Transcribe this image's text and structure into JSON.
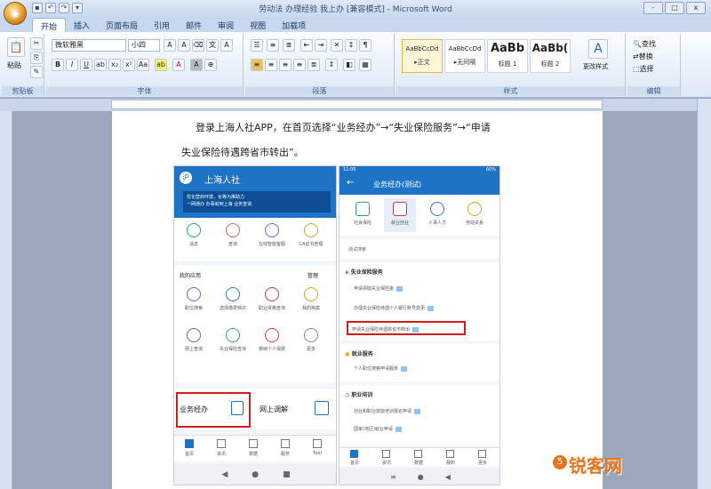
{
  "window": {
    "title": "劳动法 办理经验 我上办 [兼容模式] - Microsoft Word",
    "controls": [
      "-",
      "□",
      "x"
    ]
  },
  "tabs": [
    "开始",
    "插入",
    "页面布局",
    "引用",
    "邮件",
    "审阅",
    "视图",
    "加载项"
  ],
  "ribbon": {
    "clipboard": {
      "paste": "粘贴",
      "label": "剪贴板"
    },
    "font": {
      "name": "微软雅黑",
      "size": "小四",
      "label": "字体"
    },
    "paragraph": {
      "label": "段落"
    },
    "styles": {
      "label": "样式",
      "items": [
        {
          "preview": "AaBbCcDd",
          "name": "▸正文"
        },
        {
          "preview": "AaBbCcDd",
          "name": "▸无间隔"
        },
        {
          "preview": "AaBb",
          "name": "标题 1"
        },
        {
          "preview": "AaBb(",
          "name": "标题 2"
        }
      ],
      "change": "更改样式"
    },
    "editing": {
      "label": "编辑",
      "find": "查找",
      "replace": "替换",
      "select": "选择"
    }
  },
  "doc": {
    "line1": "登录上海人社APP，在首页选择“业务经办”→“失业保险服务”→“申请",
    "line2": "失业保险待遇跨省市转出”。"
  },
  "left_screen": {
    "app": "上海人社",
    "banner": "优化营商环境，化等为推助力",
    "banner2": "一网通办   办事就到上海  业务查询",
    "top_icons": [
      "消息",
      "查询",
      "在线智能客服",
      "CA证书管理"
    ],
    "myapps": "我的应用",
    "manage": "管理",
    "apps": [
      "职位搜索",
      "选择缴费档次",
      "职业资格查询",
      "我的档案",
      "网上查询",
      "失业保险查询",
      "缴纳个人保费",
      "更多"
    ],
    "biz": "业务经办",
    "online": "网上调解",
    "nav": [
      "首页",
      "资讯",
      "数据",
      "服务",
      "Tool"
    ]
  },
  "right_screen": {
    "status_time": "11:05",
    "status_right": "60%",
    "header": "业务经办(测试)",
    "top_icons": [
      "社会保险",
      "就业创业",
      "人事人才",
      "劳动关系"
    ],
    "search": "测试搜索",
    "sec1": "失业保险服务",
    "sec1_items": [
      "申请领取失业保险金",
      "办理失业保险待遇个人银行账号变更",
      "申请失业保险待遇跨省市转出"
    ],
    "sec2": "就业服务",
    "sec2_items": [
      "个人职位搜索",
      "申请服务"
    ],
    "sec3": "职业培训",
    "sec3_items": [
      "创业和职业技能培训报名申请",
      "国家(地区)就业申请"
    ],
    "nav": [
      "首页",
      "资讯",
      "数据",
      "我的",
      "更多"
    ]
  },
  "watermark": "锐客网"
}
